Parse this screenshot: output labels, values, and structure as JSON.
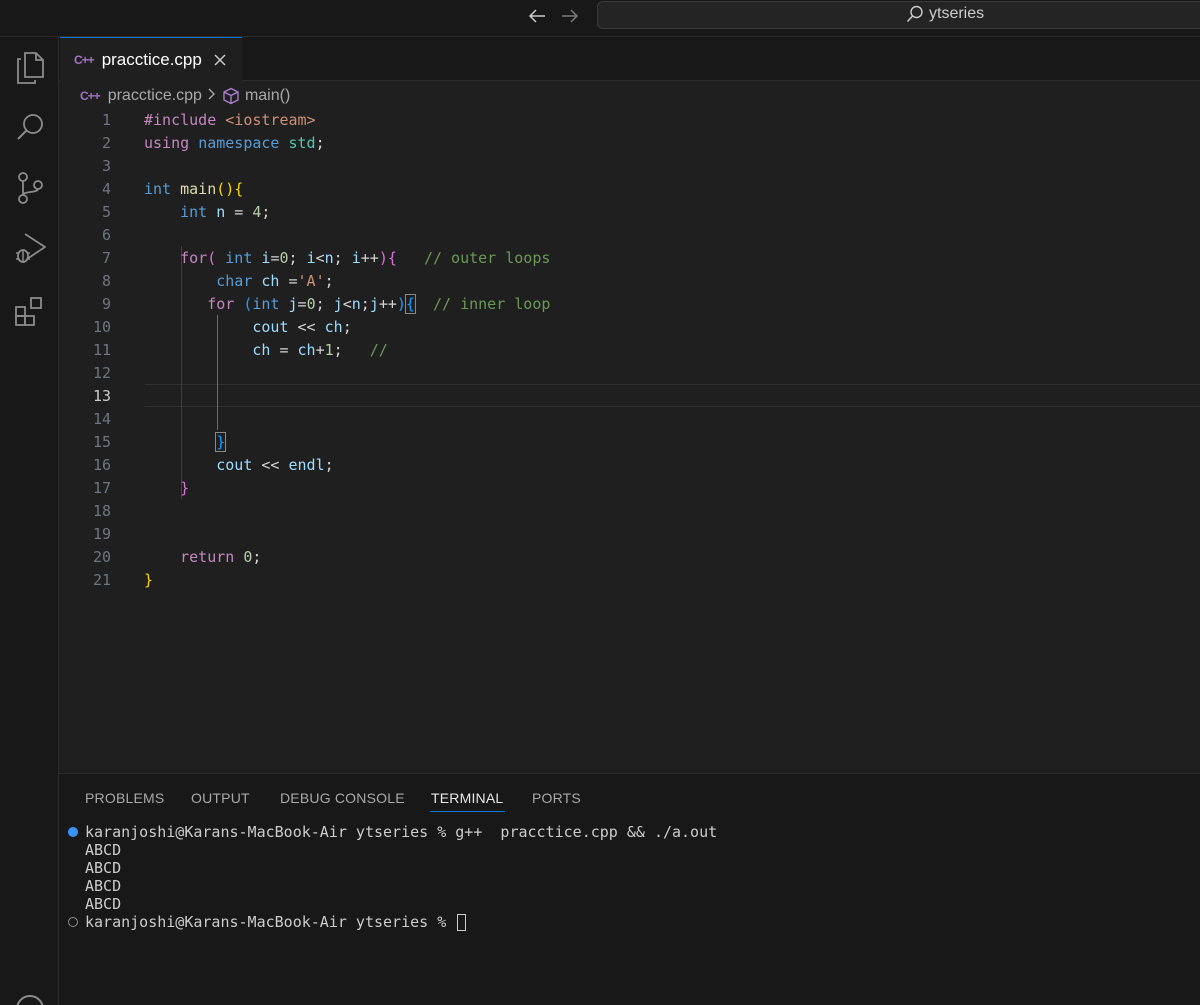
{
  "titlebar": {
    "search_text": "ytseries"
  },
  "tab": {
    "label": "pracctice.cpp",
    "icon": "C++"
  },
  "breadcrumb": {
    "file": "pracctice.cpp",
    "symbol": "main()"
  },
  "editor": {
    "active_line": 13,
    "lines": [
      {
        "n": "1",
        "segs": [
          [
            "#include ",
            "kw-pur"
          ],
          [
            "<iostream>",
            "str"
          ]
        ]
      },
      {
        "n": "2",
        "segs": [
          [
            "using ",
            "kw-pur"
          ],
          [
            "namespace ",
            "kw-blue"
          ],
          [
            "std",
            "ns"
          ],
          [
            ";",
            "pl"
          ]
        ]
      },
      {
        "n": "3",
        "segs": []
      },
      {
        "n": "4",
        "segs": [
          [
            "int ",
            "kw-blue"
          ],
          [
            "main",
            "fn"
          ],
          [
            "(){",
            "br1"
          ]
        ]
      },
      {
        "n": "5",
        "segs": [
          [
            "    int ",
            "kw-blue"
          ],
          [
            "n",
            "var"
          ],
          [
            " = ",
            "pl"
          ],
          [
            "4",
            "num"
          ],
          [
            ";",
            "pl"
          ]
        ]
      },
      {
        "n": "6",
        "segs": []
      },
      {
        "n": "7",
        "segs": [
          [
            "    for",
            "kw-pur"
          ],
          [
            "( ",
            "br2"
          ],
          [
            "int ",
            "kw-blue"
          ],
          [
            "i",
            "var"
          ],
          [
            "=",
            "pl"
          ],
          [
            "0",
            "num"
          ],
          [
            "; ",
            "pl"
          ],
          [
            "i",
            "var"
          ],
          [
            "<",
            "pl"
          ],
          [
            "n",
            "var"
          ],
          [
            "; ",
            "pl"
          ],
          [
            "i",
            "var"
          ],
          [
            "++",
            "pl"
          ],
          [
            "){",
            "br2"
          ],
          [
            "   // outer loops",
            "cmt"
          ]
        ]
      },
      {
        "n": "8",
        "segs": [
          [
            "        char ",
            "kw-blue"
          ],
          [
            "ch",
            "var"
          ],
          [
            " =",
            "pl"
          ],
          [
            "'A'",
            "str"
          ],
          [
            ";",
            "pl"
          ]
        ]
      },
      {
        "n": "9",
        "segs": [
          [
            "       for ",
            "kw-pur"
          ],
          [
            "(",
            "br3"
          ],
          [
            "int ",
            "kw-blue"
          ],
          [
            "j",
            "var"
          ],
          [
            "=",
            "pl"
          ],
          [
            "0",
            "num"
          ],
          [
            "; ",
            "pl"
          ],
          [
            "j",
            "var"
          ],
          [
            "<",
            "pl"
          ],
          [
            "n",
            "var"
          ],
          [
            ";",
            "pl"
          ],
          [
            "j",
            "var"
          ],
          [
            "++",
            "pl"
          ],
          [
            ")",
            "br3"
          ],
          [
            "{",
            "br3 bracket-box"
          ],
          [
            "  // inner loop",
            "cmt"
          ]
        ]
      },
      {
        "n": "10",
        "segs": [
          [
            "            cout ",
            "var"
          ],
          [
            "<< ",
            "pl"
          ],
          [
            "ch",
            "var"
          ],
          [
            ";",
            "pl"
          ]
        ]
      },
      {
        "n": "11",
        "segs": [
          [
            "            ch ",
            "var"
          ],
          [
            "= ",
            "pl"
          ],
          [
            "ch",
            "var"
          ],
          [
            "+",
            "pl"
          ],
          [
            "1",
            "num"
          ],
          [
            ";   ",
            "pl"
          ],
          [
            "//",
            "cmt"
          ]
        ]
      },
      {
        "n": "12",
        "segs": []
      },
      {
        "n": "13",
        "segs": []
      },
      {
        "n": "14",
        "segs": []
      },
      {
        "n": "15",
        "segs": [
          [
            "        ",
            "pl"
          ],
          [
            "}",
            "br3 bracket-box"
          ]
        ]
      },
      {
        "n": "16",
        "segs": [
          [
            "        cout ",
            "var"
          ],
          [
            "<< ",
            "pl"
          ],
          [
            "endl",
            "var"
          ],
          [
            ";",
            "pl"
          ]
        ]
      },
      {
        "n": "17",
        "segs": [
          [
            "    }",
            "br2"
          ]
        ]
      },
      {
        "n": "18",
        "segs": []
      },
      {
        "n": "19",
        "segs": []
      },
      {
        "n": "20",
        "segs": [
          [
            "    return ",
            "kw-pur"
          ],
          [
            "0",
            "num"
          ],
          [
            ";",
            "pl"
          ]
        ]
      },
      {
        "n": "21",
        "segs": [
          [
            "}",
            "br1"
          ]
        ]
      }
    ]
  },
  "panel": {
    "tabs": [
      "PROBLEMS",
      "OUTPUT",
      "DEBUG CONSOLE",
      "TERMINAL",
      "PORTS"
    ],
    "active_tab": "TERMINAL",
    "terminal": {
      "command_line": "karanjoshi@Karans-MacBook-Air ytseries % g++  pracctice.cpp && ./a.out",
      "output": [
        "ABCD",
        "ABCD",
        "ABCD",
        "ABCD"
      ],
      "prompt": "karanjoshi@Karans-MacBook-Air ytseries % "
    }
  },
  "colors": {
    "accent": "#0078d4",
    "editor_bg": "#1f1f1f",
    "chrome_bg": "#181818",
    "cpp_icon": "#a074c4",
    "success_dot": "#3794ff"
  }
}
